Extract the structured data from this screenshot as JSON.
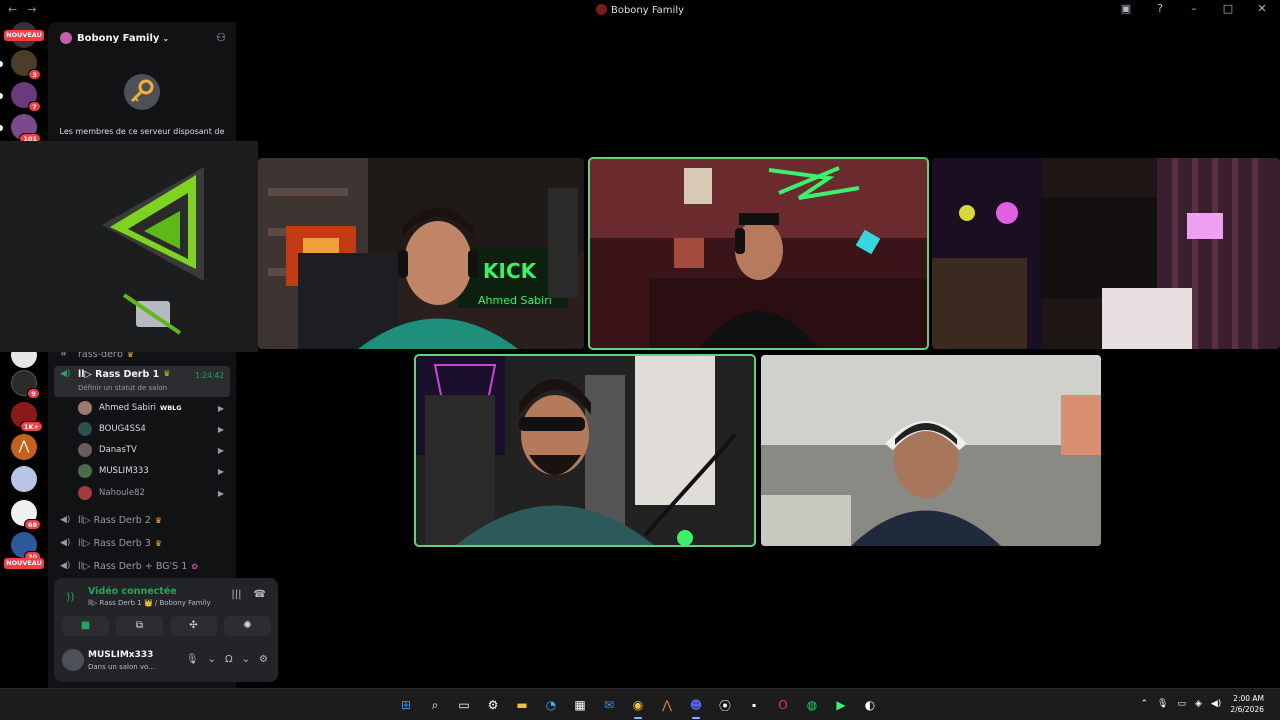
{
  "window": {
    "title": "Bobony Family",
    "back": "←",
    "forward": "→"
  },
  "rail": {
    "new_top": "NOUVEAU",
    "new_bottom": "NOUVEAU",
    "badges": [
      "3",
      "7",
      "101",
      "9",
      "1K+",
      "68",
      "20"
    ]
  },
  "server": {
    "name": "Bobony Family",
    "members_note": "Les membres de ce serveur disposant de"
  },
  "channels": {
    "partial": "rass-derb",
    "active": {
      "name": "ll▷ Rass Derb 1",
      "timer": "1:24:42",
      "status": "Définir un statut de salon"
    },
    "members": [
      {
        "name": "Ahmed Sabiri",
        "tag": "WBLG",
        "color": "#9b7b6a"
      },
      {
        "name": "BOUG4SS4",
        "color": "#2f4f4f"
      },
      {
        "name": "DanasTV",
        "color": "#6b5b5b"
      },
      {
        "name": "MUSLIM333",
        "color": "#4b6b4b"
      },
      {
        "name": "Nahoule82",
        "color": "#a33b3b"
      }
    ],
    "others": [
      {
        "name": "ll▷ Rass Derb 2"
      },
      {
        "name": "ll▷ Rass Derb 3"
      },
      {
        "name": "ll▷ Rass Derb + BG'S 1"
      }
    ]
  },
  "voice": {
    "title": "Vidéo connectée",
    "sub": "ll▷ Rass Derb 1 👑 / Bobony Family"
  },
  "user": {
    "name": "MUSLIMx333",
    "status": "Dans un salon vo..."
  },
  "tiles": [
    {
      "label": "tile-ahmed-sabiri",
      "speaking": false
    },
    {
      "label": "tile-center",
      "speaking": true
    },
    {
      "label": "tile-right",
      "speaking": false
    },
    {
      "label": "tile-bottom-left",
      "speaking": true
    },
    {
      "label": "tile-bottom-right",
      "speaking": false
    }
  ],
  "stream_text": {
    "kick_overlay": "KICK",
    "kick_name": "Ahmed Sabiri"
  },
  "taskbar": {
    "time": "2:00 AM",
    "date": "2/6/2026"
  },
  "colors": {
    "accent_green": "#23a55a",
    "speaking_outline": "#63d27a",
    "badge_red": "#f23f43"
  }
}
